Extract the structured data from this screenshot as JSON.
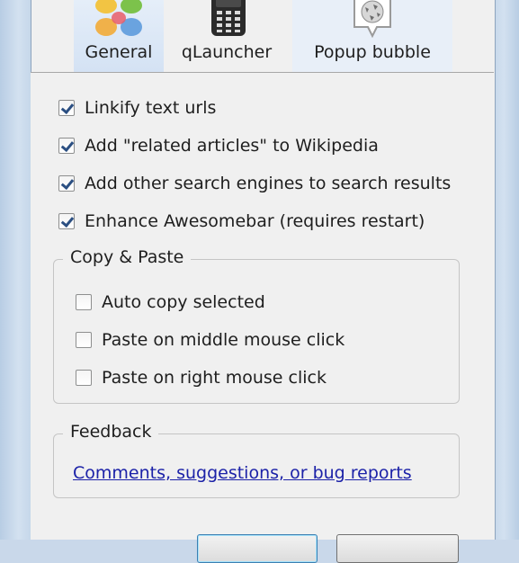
{
  "tabs": [
    {
      "label": "General",
      "icon": "color-dots-icon",
      "selected": true
    },
    {
      "label": "qLauncher",
      "icon": "phone-icon",
      "selected": false
    },
    {
      "label": "Popup bubble",
      "icon": "wikipedia-globe-icon",
      "selected": false
    }
  ],
  "general": {
    "options": [
      {
        "label": "Linkify text urls",
        "checked": true
      },
      {
        "label": "Add \"related articles\" to Wikipedia",
        "checked": true
      },
      {
        "label": "Add other search engines to search results",
        "checked": true
      },
      {
        "label": "Enhance Awesomebar (requires restart)",
        "checked": true
      }
    ],
    "copy_paste": {
      "title": "Copy & Paste",
      "options": [
        {
          "label": "Auto copy selected",
          "checked": false
        },
        {
          "label": "Paste on middle mouse click",
          "checked": false
        },
        {
          "label": "Paste on right mouse click",
          "checked": false
        }
      ]
    },
    "feedback": {
      "title": "Feedback",
      "link": "Comments, suggestions, or bug reports"
    }
  },
  "colors": {
    "link": "#1c22a8",
    "selected_tab": "#d4e2f4",
    "check": "#2b4f82"
  }
}
